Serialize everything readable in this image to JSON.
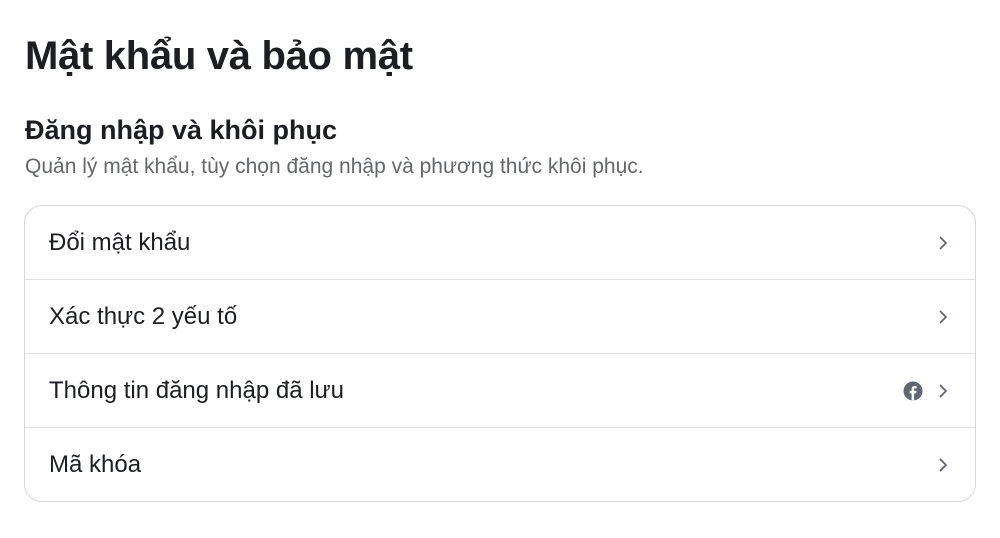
{
  "page": {
    "title": "Mật khẩu và bảo mật"
  },
  "section": {
    "title": "Đăng nhập và khôi phục",
    "description": "Quản lý mật khẩu, tùy chọn đăng nhập và phương thức khôi phục."
  },
  "items": [
    {
      "label": "Đổi mật khẩu",
      "icons": [
        "chevron-right-icon"
      ]
    },
    {
      "label": "Xác thực 2 yếu tố",
      "icons": [
        "chevron-right-icon"
      ]
    },
    {
      "label": "Thông tin đăng nhập đã lưu",
      "icons": [
        "facebook-icon",
        "chevron-right-icon"
      ]
    },
    {
      "label": "Mã khóa",
      "icons": [
        "chevron-right-icon"
      ]
    }
  ],
  "colors": {
    "text_primary": "#1c1e21",
    "text_secondary": "#65676b",
    "border": "#d5d8dc",
    "icon": "#606770"
  }
}
